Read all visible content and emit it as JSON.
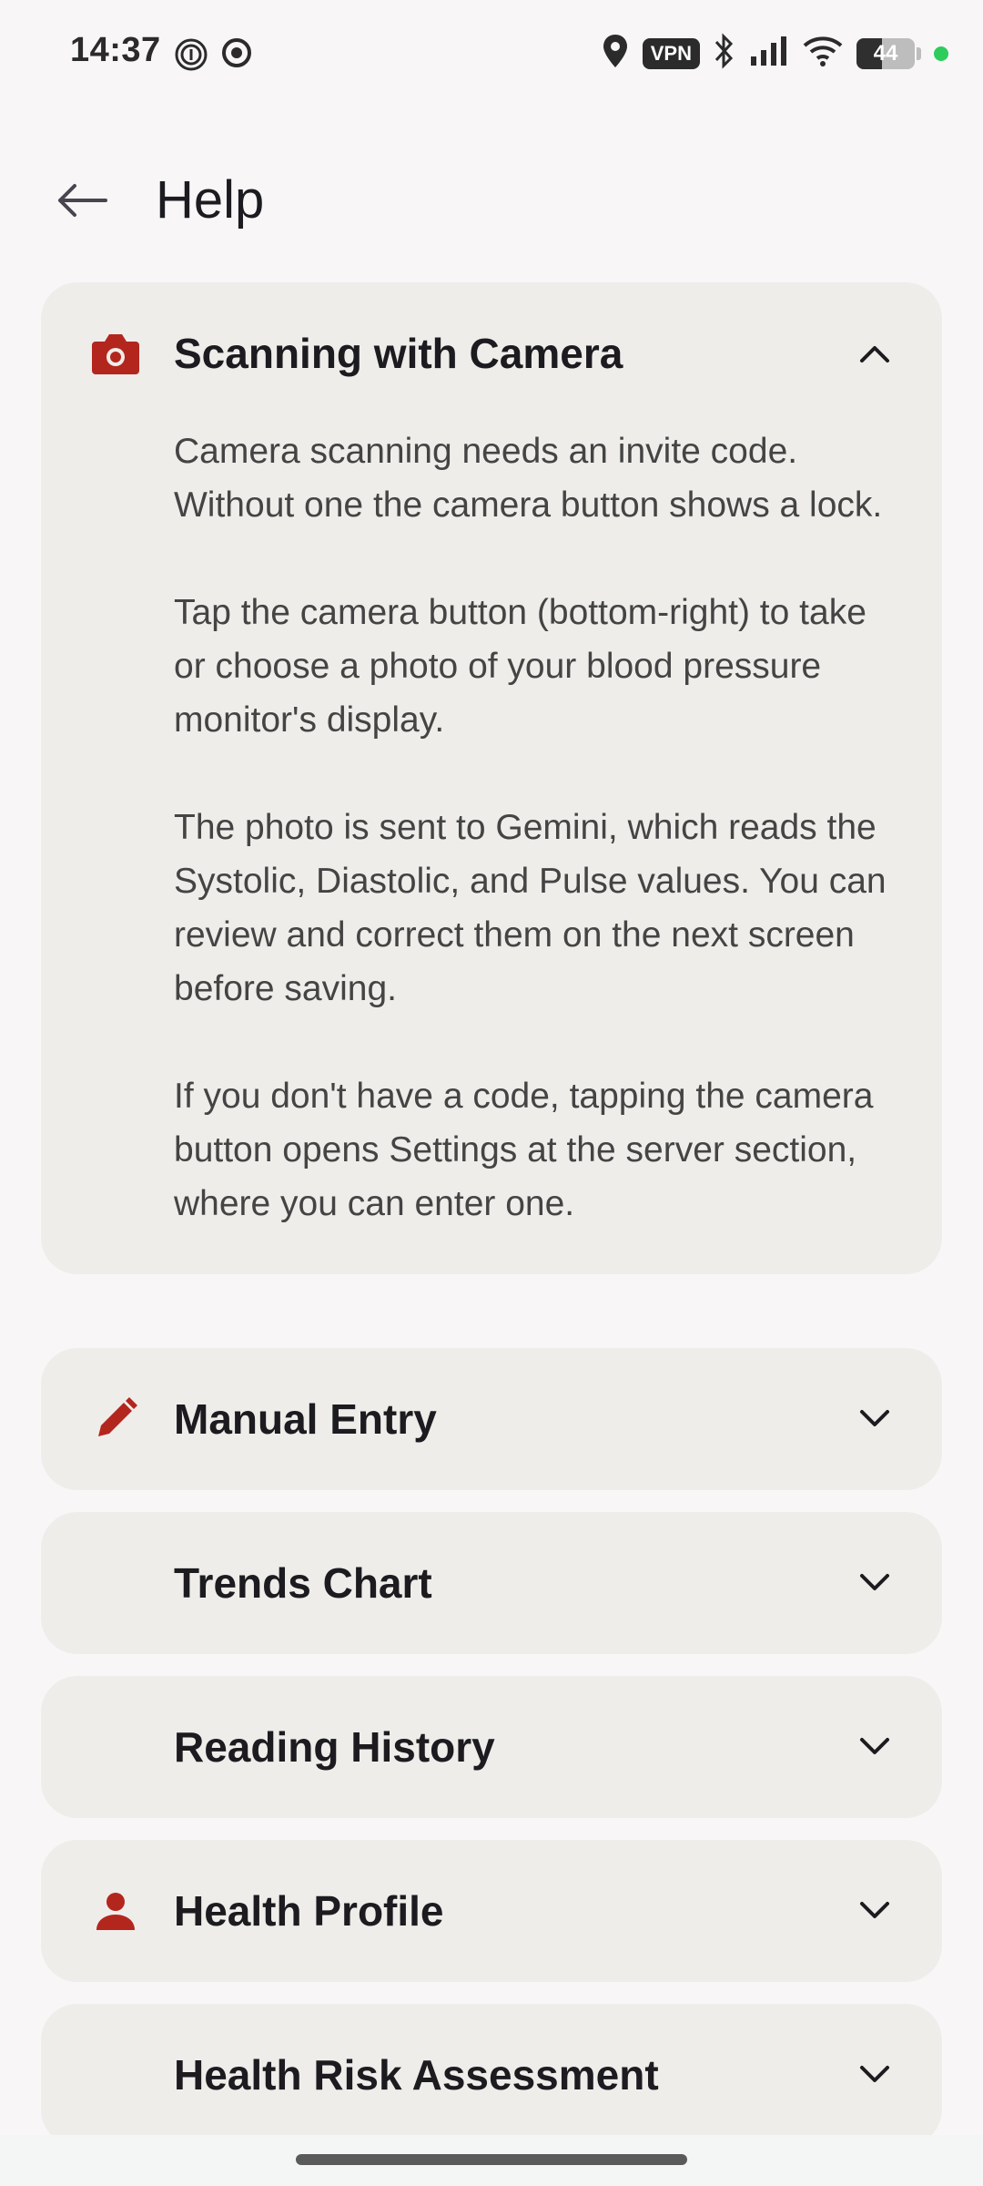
{
  "status_bar": {
    "time": "14:37",
    "vpn": "VPN",
    "battery": "44",
    "battery_level_percent": 44
  },
  "app_bar": {
    "title": "Help"
  },
  "sections": [
    {
      "title": "Scanning with Camera",
      "icon": "camera-icon",
      "expanded": true,
      "paragraphs": [
        "Camera scanning needs an invite code. Without one the camera button shows a lock.",
        "Tap the camera button (bottom-right) to take or choose a photo of your blood pressure monitor's display.",
        "The photo is sent to Gemini, which reads the Systolic, Diastolic, and Pulse values. You can review and correct them on the next screen before saving.",
        "If you don't have a code, tapping the camera button opens Settings at the server section, where you can enter one."
      ]
    },
    {
      "title": "Manual Entry",
      "icon": "pencil-icon",
      "expanded": false
    },
    {
      "title": "Trends Chart",
      "icon": "",
      "expanded": false
    },
    {
      "title": "Reading History",
      "icon": "",
      "expanded": false
    },
    {
      "title": "Health Profile",
      "icon": "person-icon",
      "expanded": false
    },
    {
      "title": "Health Risk Assessment",
      "icon": "",
      "expanded": false
    }
  ],
  "colors": {
    "accent": "#b3261e",
    "card_bg": "#efedea",
    "page_bg": "#f8f6f7"
  }
}
